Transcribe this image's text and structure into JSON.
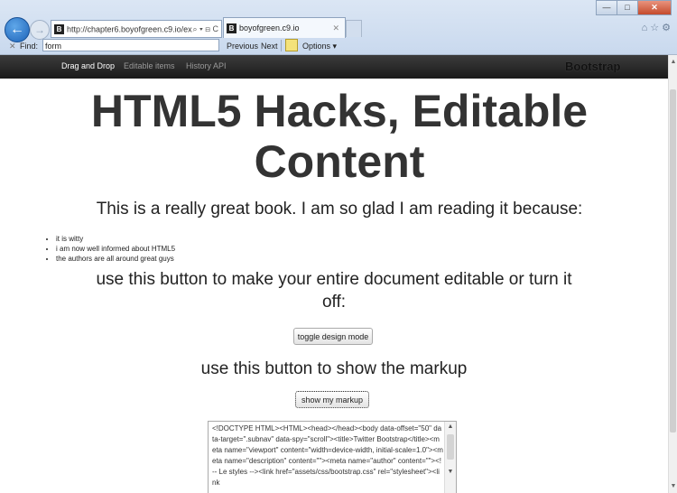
{
  "browser": {
    "address_url": "http://chapter6.boyofgreen.c9.io/ex",
    "address_controls": "⌕ ▾ ⊟ C",
    "tab_title": "boyofgreen.c9.io",
    "favicon_letter": "B",
    "find_label": "Find:",
    "find_value": "form",
    "find_prev": "Previous",
    "find_next": "Next",
    "find_options": "Options ▾"
  },
  "navbar": {
    "items": [
      {
        "label": "Drag and Drop",
        "active": true
      },
      {
        "label": "Editable items",
        "active": false
      },
      {
        "label": "History API",
        "active": false
      }
    ],
    "brand": "Bootstrap"
  },
  "page": {
    "title_line1": "HTML5 Hacks, Editable",
    "title_line2": "Content",
    "lead": "This is a really great book. I am so glad I am reading it because:",
    "reasons": [
      "it is witty",
      "i am now well informed about HTML5",
      "the authors are all around great guys"
    ],
    "design_text_line1": "use this button to make your entire document editable or turn it",
    "design_text_line2": "off:",
    "design_button": "toggle design mode",
    "markup_text": "use this button to show the markup",
    "markup_button": "show my markup",
    "markup_content": "<!DOCTYPE HTML><HTML><head></head><body data-offset=\"50\" data-target=\".subnav\" data-spy=\"scroll\"><title>Twitter Bootstrap</title><meta name=\"viewport\" content=\"width=device-width, initial-scale=1.0\"><meta name=\"description\" content=\"\"><meta name=\"author\" content=\"\"><!-- Le styles --><link href=\"assets/css/bootstrap.css\" rel=\"stylesheet\"><link"
  }
}
